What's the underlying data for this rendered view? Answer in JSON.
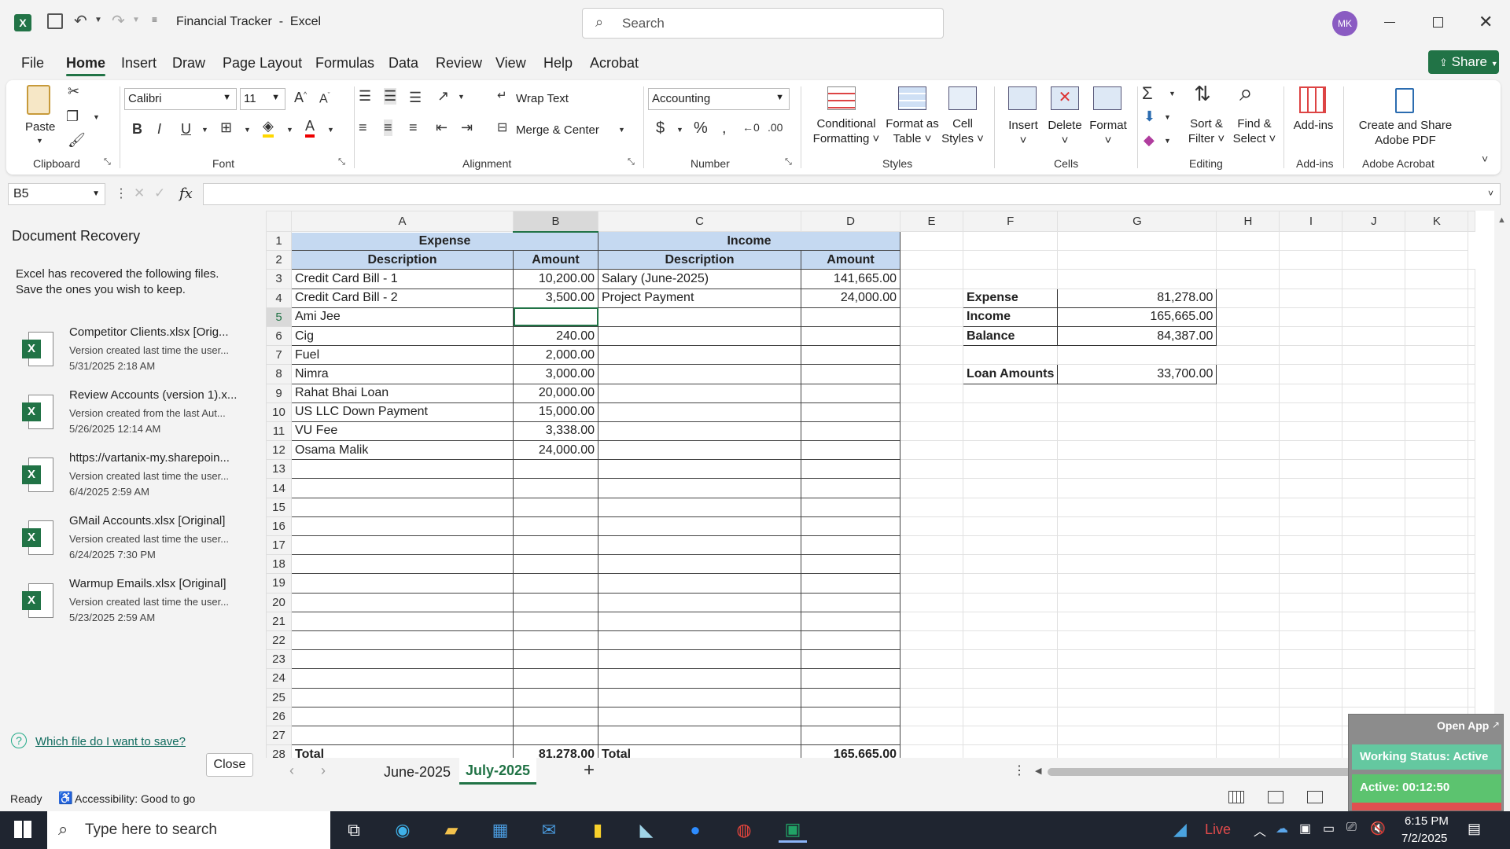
{
  "titlebar": {
    "app_title": "Financial Tracker  -  Excel",
    "search_placeholder": "Search",
    "avatar": "MK"
  },
  "tabs": [
    "File",
    "Home",
    "Insert",
    "Draw",
    "Page Layout",
    "Formulas",
    "Data",
    "Review",
    "View",
    "Help",
    "Acrobat"
  ],
  "share_label": "Share",
  "ribbon": {
    "paste": "Paste",
    "clipboard": "Clipboard",
    "font_name": "Calibri",
    "font_size": "11",
    "font": "Font",
    "wrap_text": "Wrap Text",
    "merge_center": "Merge & Center",
    "alignment": "Alignment",
    "number_format": "Accounting",
    "number": "Number",
    "cond_fmt_1": "Conditional",
    "cond_fmt_2": "Formatting",
    "fmt_table_1": "Format as",
    "fmt_table_2": "Table",
    "cell_styles_1": "Cell",
    "cell_styles_2": "Styles",
    "styles": "Styles",
    "insert": "Insert",
    "delete": "Delete",
    "format": "Format",
    "cells": "Cells",
    "sort_1": "Sort &",
    "sort_2": "Filter",
    "find_1": "Find &",
    "find_2": "Select",
    "editing": "Editing",
    "addins": "Add-ins",
    "addins_group": "Add-ins",
    "acrobat_1": "Create and Share",
    "acrobat_2": "Adobe PDF",
    "acrobat_group": "Adobe Acrobat"
  },
  "formula_bar": {
    "name_box": "B5",
    "fx": "fx",
    "value": ""
  },
  "recovery": {
    "title": "Document Recovery",
    "desc_1": "Excel has recovered the following files.",
    "desc_2": "Save the ones you wish to keep.",
    "files": [
      {
        "name": "Competitor Clients.xlsx  [Orig...",
        "desc": "Version created last time the user...",
        "time": "5/31/2025 2:18 AM"
      },
      {
        "name": "Review Accounts (version 1).x...",
        "desc": "Version created from the last Aut...",
        "time": "5/26/2025 12:14 AM"
      },
      {
        "name": "https://vartanix-my.sharepoin...",
        "desc": "Version created last time the user...",
        "time": "6/4/2025 2:59 AM"
      },
      {
        "name": "GMail Accounts.xlsx  [Original]",
        "desc": "Version created last time the user...",
        "time": "6/24/2025 7:30 PM"
      },
      {
        "name": "Warmup Emails.xlsx  [Original]",
        "desc": "Version created last time the user...",
        "time": "5/23/2025 2:59 AM"
      }
    ],
    "help_link": "Which file do I want to save?",
    "close": "Close"
  },
  "sheet": {
    "columns": [
      "A",
      "B",
      "C",
      "D",
      "E",
      "F",
      "G",
      "H",
      "I",
      "J",
      "K"
    ],
    "h_expense": "Expense",
    "h_income": "Income",
    "h_desc": "Description",
    "h_amount": "Amount",
    "expenses": [
      [
        "Credit Card Bill - 1",
        "10,200.00"
      ],
      [
        "Credit Card Bill - 2",
        "3,500.00"
      ],
      [
        "Ami Jee",
        ""
      ],
      [
        "Cig",
        "240.00"
      ],
      [
        "Fuel",
        "2,000.00"
      ],
      [
        "Nimra",
        "3,000.00"
      ],
      [
        "Rahat Bhai Loan",
        "20,000.00"
      ],
      [
        "US LLC Down Payment",
        "15,000.00"
      ],
      [
        "VU Fee",
        "3,338.00"
      ],
      [
        "Osama Malik",
        "24,000.00"
      ]
    ],
    "income": [
      [
        "Salary (June-2025)",
        "141,665.00"
      ],
      [
        "Project Payment",
        "24,000.00"
      ]
    ],
    "total_label": "Total",
    "total_expense": "81,278.00",
    "total_income": "165,665.00",
    "summary": [
      [
        "Expense",
        "81,278.00"
      ],
      [
        "Income",
        "165,665.00"
      ],
      [
        "Balance",
        "84,387.00"
      ]
    ],
    "loan_label": "Loan Amounts",
    "loan_value": "33,700.00"
  },
  "sheet_tabs": [
    "June-2025",
    "July-2025"
  ],
  "status": {
    "ready": "Ready",
    "accessibility": "Accessibility: Good to go"
  },
  "overlay": {
    "open_app": "Open App",
    "working": "Working Status: Active",
    "active": "Active: 00:12:50"
  },
  "taskbar": {
    "search": "Type here to search",
    "live": "Live",
    "time": "6:15 PM",
    "date": "7/2/2025"
  },
  "colors": {
    "excel_green": "#217346",
    "header_fill": "#c5d9f1",
    "overlay_green": "#5cc36f"
  }
}
